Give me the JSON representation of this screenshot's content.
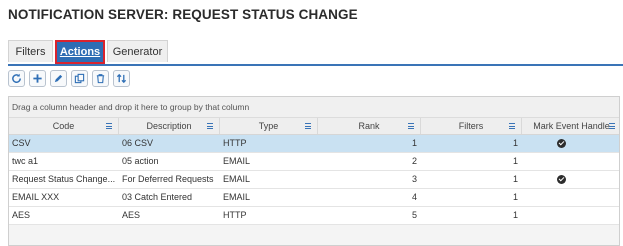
{
  "page": {
    "title": "NOTIFICATION SERVER: REQUEST STATUS CHANGE"
  },
  "tabs": [
    {
      "label": "Filters",
      "active": false
    },
    {
      "label": "Actions",
      "active": true
    },
    {
      "label": "Generator",
      "active": false
    }
  ],
  "toolbar": {
    "buttons": [
      "refresh-icon",
      "add-icon",
      "edit-icon",
      "copy-icon",
      "delete-icon",
      "sort-icon"
    ]
  },
  "grid": {
    "group_hint": "Drag a column header and drop it here to group by that column",
    "columns": [
      "Code",
      "Description",
      "Type",
      "Rank",
      "Filters",
      "Mark Event Handle"
    ],
    "rows": [
      {
        "code": "CSV",
        "description": "06 CSV",
        "type": "HTTP",
        "rank": "1",
        "filters": "1",
        "mark_event_handle": true,
        "selected": true
      },
      {
        "code": "twc a1",
        "description": "05 action",
        "type": "EMAIL",
        "rank": "2",
        "filters": "1",
        "mark_event_handle": false,
        "selected": false
      },
      {
        "code": "Request Status Change...",
        "description": "For Deferred Requests",
        "type": "EMAIL",
        "rank": "3",
        "filters": "1",
        "mark_event_handle": true,
        "selected": false
      },
      {
        "code": "EMAIL XXX",
        "description": "03 Catch Entered",
        "type": "EMAIL",
        "rank": "4",
        "filters": "1",
        "mark_event_handle": false,
        "selected": false
      },
      {
        "code": "AES",
        "description": "AES",
        "type": "HTTP",
        "rank": "5",
        "filters": "1",
        "mark_event_handle": false,
        "selected": false
      }
    ]
  },
  "colors": {
    "accent": "#2e6db4",
    "selected_row": "#c9e1f2",
    "active_tab_outline": "#d9232e"
  }
}
